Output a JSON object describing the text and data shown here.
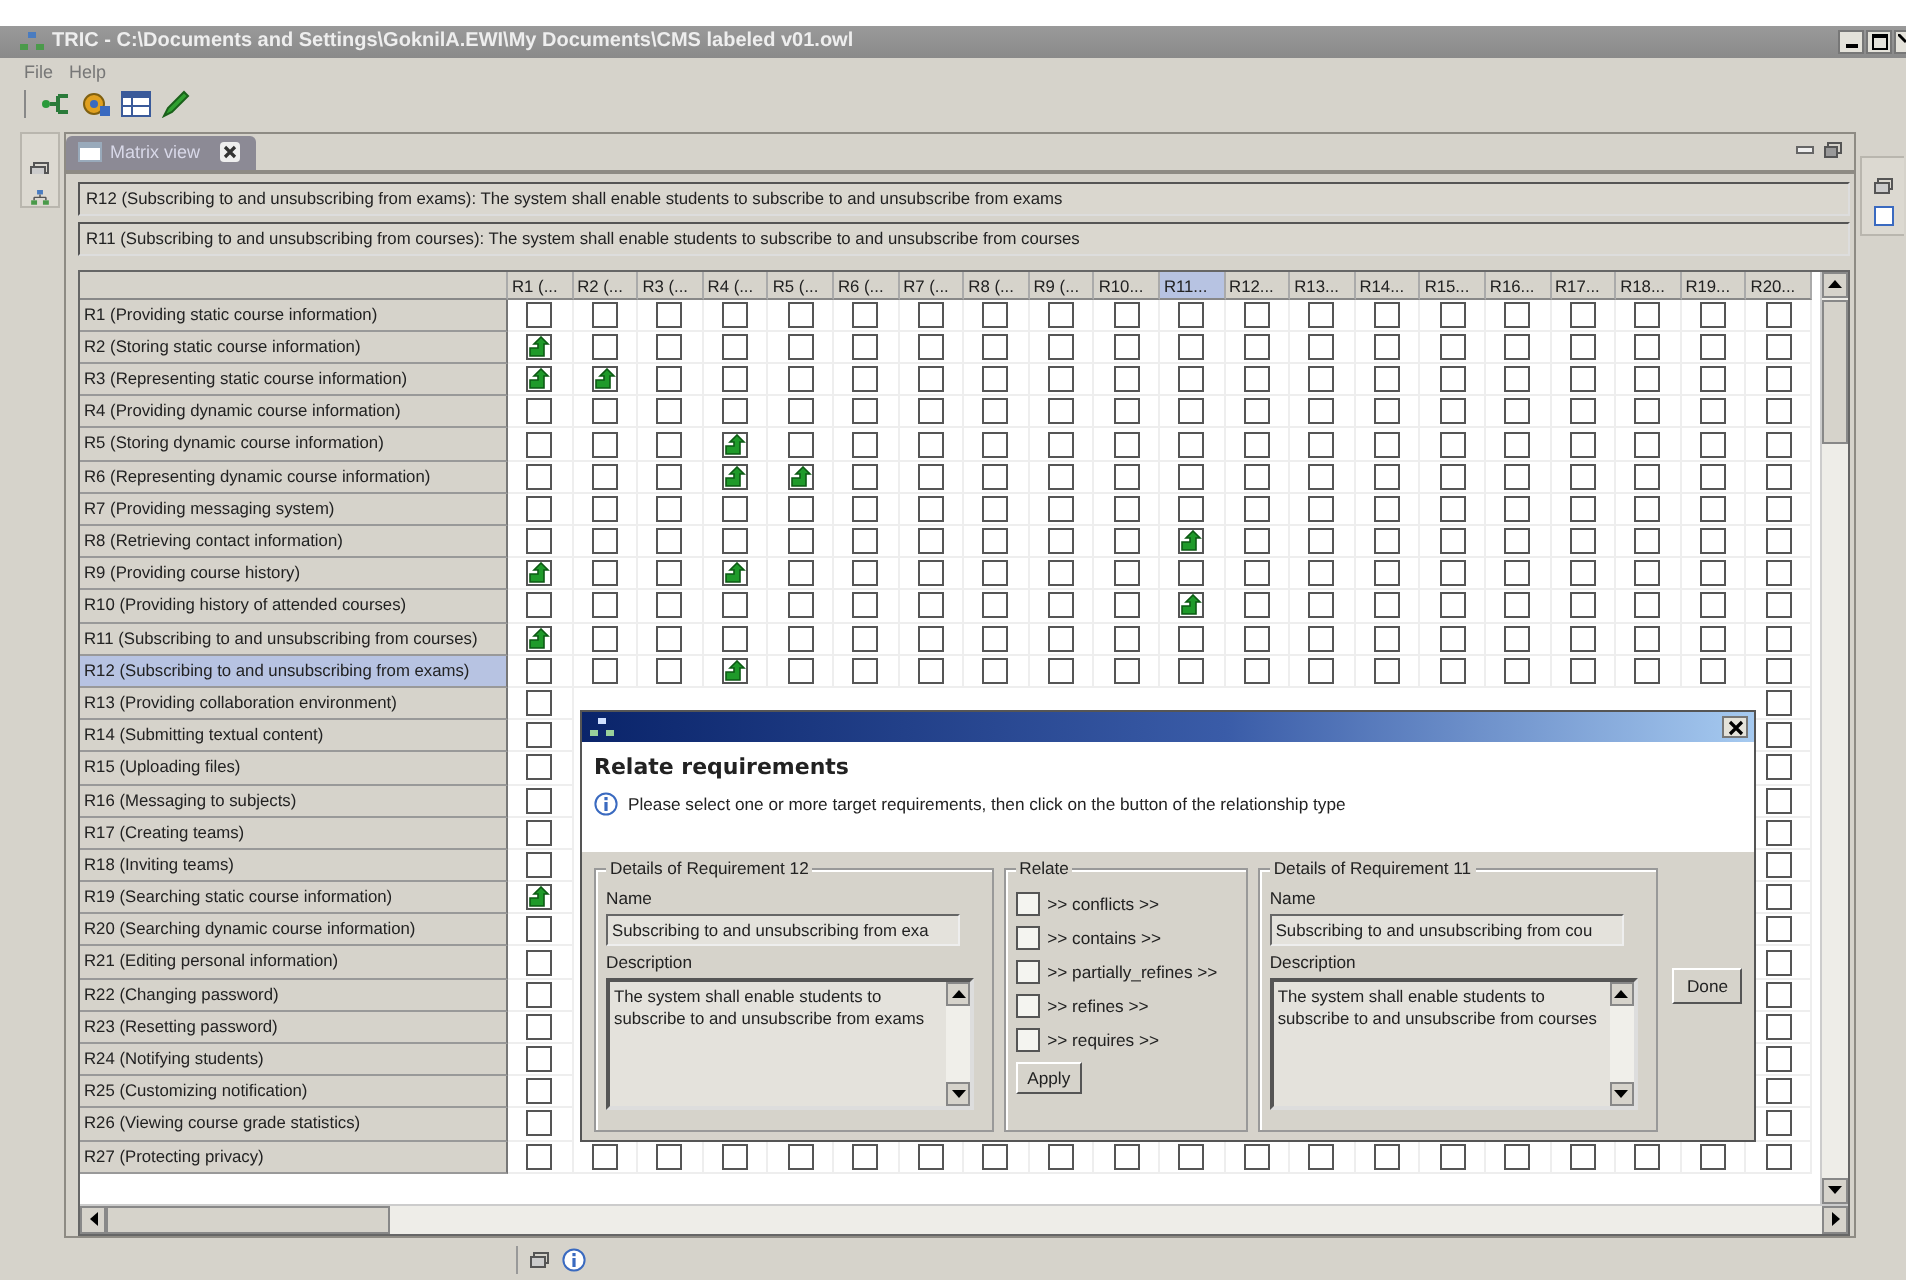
{
  "window": {
    "title": "TRIC - C:\\Documents and Settings\\GoknilA.EWI\\My Documents\\CMS labeled v01.owl"
  },
  "menu": [
    "File",
    "Help"
  ],
  "tab": {
    "label": "Matrix view",
    "selected": true
  },
  "info_lines": [
    "R12 (Subscribing to and unsubscribing from exams): The system shall enable students to subscribe to and unsubscribe from exams",
    "R11 (Subscribing to and unsubscribing from courses): The system shall enable students to subscribe to and unsubscribe from courses"
  ],
  "matrix": {
    "columns": [
      {
        "label": "R1 (...",
        "selected": false
      },
      {
        "label": "R2 (...",
        "selected": false
      },
      {
        "label": "R3 (...",
        "selected": false
      },
      {
        "label": "R4 (...",
        "selected": false
      },
      {
        "label": "R5 (...",
        "selected": false
      },
      {
        "label": "R6 (...",
        "selected": false
      },
      {
        "label": "R7 (...",
        "selected": false
      },
      {
        "label": "R8 (...",
        "selected": false
      },
      {
        "label": "R9 (...",
        "selected": false
      },
      {
        "label": "R10...",
        "selected": false
      },
      {
        "label": "R11...",
        "selected": true
      },
      {
        "label": "R12...",
        "selected": false
      },
      {
        "label": "R13...",
        "selected": false
      },
      {
        "label": "R14...",
        "selected": false
      },
      {
        "label": "R15...",
        "selected": false
      },
      {
        "label": "R16...",
        "selected": false
      },
      {
        "label": "R17...",
        "selected": false
      },
      {
        "label": "R18...",
        "selected": false
      },
      {
        "label": "R19...",
        "selected": false
      },
      {
        "label": "R20...",
        "selected": false
      }
    ],
    "rows": [
      {
        "label": "R1 (Providing static course information)",
        "selected": false,
        "cells": [
          false,
          false,
          false,
          false,
          false,
          false,
          false,
          false,
          false,
          false,
          false,
          false,
          false,
          false,
          false,
          false,
          false,
          false,
          false,
          false
        ]
      },
      {
        "label": "R2 (Storing static course information)",
        "selected": false,
        "cells": [
          true,
          false,
          false,
          false,
          false,
          false,
          false,
          false,
          false,
          false,
          false,
          false,
          false,
          false,
          false,
          false,
          false,
          false,
          false,
          false
        ]
      },
      {
        "label": "R3 (Representing static course information)",
        "selected": false,
        "cells": [
          true,
          true,
          false,
          false,
          false,
          false,
          false,
          false,
          false,
          false,
          false,
          false,
          false,
          false,
          false,
          false,
          false,
          false,
          false,
          false
        ]
      },
      {
        "label": "R4 (Providing dynamic course information)",
        "selected": false,
        "cells": [
          false,
          false,
          false,
          false,
          false,
          false,
          false,
          false,
          false,
          false,
          false,
          false,
          false,
          false,
          false,
          false,
          false,
          false,
          false,
          false
        ]
      },
      {
        "label": "R5 (Storing dynamic course information)",
        "selected": false,
        "cells": [
          false,
          false,
          false,
          true,
          false,
          false,
          false,
          false,
          false,
          false,
          false,
          false,
          false,
          false,
          false,
          false,
          false,
          false,
          false,
          false
        ]
      },
      {
        "label": "R6 (Representing dynamic course information)",
        "selected": false,
        "cells": [
          false,
          false,
          false,
          true,
          true,
          false,
          false,
          false,
          false,
          false,
          false,
          false,
          false,
          false,
          false,
          false,
          false,
          false,
          false,
          false
        ]
      },
      {
        "label": "R7 (Providing messaging system)",
        "selected": false,
        "cells": [
          false,
          false,
          false,
          false,
          false,
          false,
          false,
          false,
          false,
          false,
          false,
          false,
          false,
          false,
          false,
          false,
          false,
          false,
          false,
          false
        ]
      },
      {
        "label": "R8 (Retrieving contact information)",
        "selected": false,
        "cells": [
          false,
          false,
          false,
          false,
          false,
          false,
          false,
          false,
          false,
          false,
          true,
          false,
          false,
          false,
          false,
          false,
          false,
          false,
          false,
          false
        ]
      },
      {
        "label": "R9 (Providing course history)",
        "selected": false,
        "cells": [
          true,
          false,
          false,
          true,
          false,
          false,
          false,
          false,
          false,
          false,
          false,
          false,
          false,
          false,
          false,
          false,
          false,
          false,
          false,
          false
        ]
      },
      {
        "label": "R10 (Providing history of attended courses)",
        "selected": false,
        "cells": [
          false,
          false,
          false,
          false,
          false,
          false,
          false,
          false,
          false,
          false,
          true,
          false,
          false,
          false,
          false,
          false,
          false,
          false,
          false,
          false
        ]
      },
      {
        "label": "R11 (Subscribing to and unsubscribing from courses)",
        "selected": false,
        "cells": [
          true,
          false,
          false,
          false,
          false,
          false,
          false,
          false,
          false,
          false,
          false,
          false,
          false,
          false,
          false,
          false,
          false,
          false,
          false,
          false
        ]
      },
      {
        "label": "R12 (Subscribing to and unsubscribing from exams)",
        "selected": true,
        "cells": [
          false,
          false,
          false,
          true,
          false,
          false,
          false,
          false,
          false,
          false,
          false,
          false,
          false,
          false,
          false,
          false,
          false,
          false,
          false,
          false
        ]
      },
      {
        "label": "R13 (Providing collaboration environment)",
        "selected": false,
        "cells": [
          false,
          false
        ]
      },
      {
        "label": "R14 (Submitting textual content)",
        "selected": false,
        "cells": [
          false,
          false
        ]
      },
      {
        "label": "R15 (Uploading files)",
        "selected": false,
        "cells": [
          false,
          false
        ]
      },
      {
        "label": "R16 (Messaging to subjects)",
        "selected": false,
        "cells": [
          false,
          false
        ]
      },
      {
        "label": "R17 (Creating teams)",
        "selected": false,
        "cells": [
          false,
          false
        ]
      },
      {
        "label": "R18 (Inviting teams)",
        "selected": false,
        "cells": [
          false,
          false
        ]
      },
      {
        "label": "R19 (Searching static course information)",
        "selected": false,
        "cells": [
          true,
          false
        ]
      },
      {
        "label": "R20 (Searching dynamic course information)",
        "selected": false,
        "cells": [
          false,
          false
        ]
      },
      {
        "label": "R21 (Editing personal information)",
        "selected": false,
        "cells": [
          false,
          false
        ]
      },
      {
        "label": "R22 (Changing password)",
        "selected": false,
        "cells": [
          false,
          false
        ]
      },
      {
        "label": "R23 (Resetting password)",
        "selected": false,
        "cells": [
          false,
          false
        ]
      },
      {
        "label": "R24 (Notifying students)",
        "selected": false,
        "cells": [
          false,
          false
        ]
      },
      {
        "label": "R25 (Customizing notification)",
        "selected": false,
        "cells": [
          false,
          false
        ]
      },
      {
        "label": "R26 (Viewing course grade statistics)",
        "selected": false,
        "cells": [
          false,
          false
        ]
      },
      {
        "label": "R27 (Protecting privacy)",
        "selected": false,
        "cells": [
          false,
          false,
          false,
          false,
          false,
          false,
          false,
          false,
          false,
          false,
          false,
          false,
          false,
          false,
          false,
          false,
          false,
          false,
          false,
          false
        ]
      }
    ]
  },
  "dialog": {
    "heading": "Relate requirements",
    "message": "Please select one or more target requirements, then click on the button of the relationship type",
    "source": {
      "legend": "Details of Requirement 12",
      "name_label": "Name",
      "name_value": "Subscribing to and unsubscribing from exa",
      "description_label": "Description",
      "description": "The system shall enable students to subscribe to and unsubscribe from exams"
    },
    "relate": {
      "legend": "Relate",
      "options": [
        {
          "label": ">> conflicts >>",
          "checked": false
        },
        {
          "label": ">> contains >>",
          "checked": false
        },
        {
          "label": ">> partially_refines >>",
          "checked": false
        },
        {
          "label": ">> refines >>",
          "checked": false
        },
        {
          "label": ">> requires >>",
          "checked": false
        }
      ],
      "apply": "Apply"
    },
    "target": {
      "legend": "Details of Requirement 11",
      "name_label": "Name",
      "name_value": "Subscribing to and unsubscribing from cou",
      "description_label": "Description",
      "description": "The system shall enable students to subscribe to and unsubscribe from courses"
    },
    "done": "Done"
  }
}
